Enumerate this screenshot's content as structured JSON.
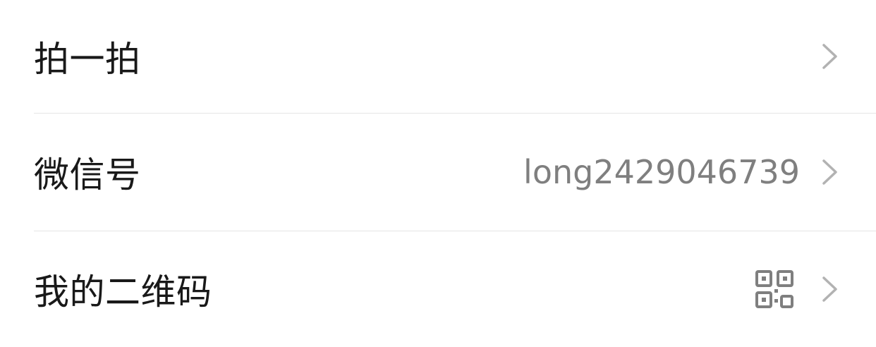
{
  "rows": [
    {
      "label": "拍一拍",
      "value": "",
      "trailing_icon": "chevron-right-icon"
    },
    {
      "label": "微信号",
      "value": "long2429046739",
      "trailing_icon": "chevron-right-icon"
    },
    {
      "label": "我的二维码",
      "value": "",
      "value_icon": "qr-code-icon",
      "trailing_icon": "chevron-right-icon"
    }
  ],
  "colors": {
    "label": "#191919",
    "value": "#7f7f7f",
    "chevron": "#b2b2b2",
    "divider": "#e5e5e5",
    "background": "#ffffff"
  }
}
